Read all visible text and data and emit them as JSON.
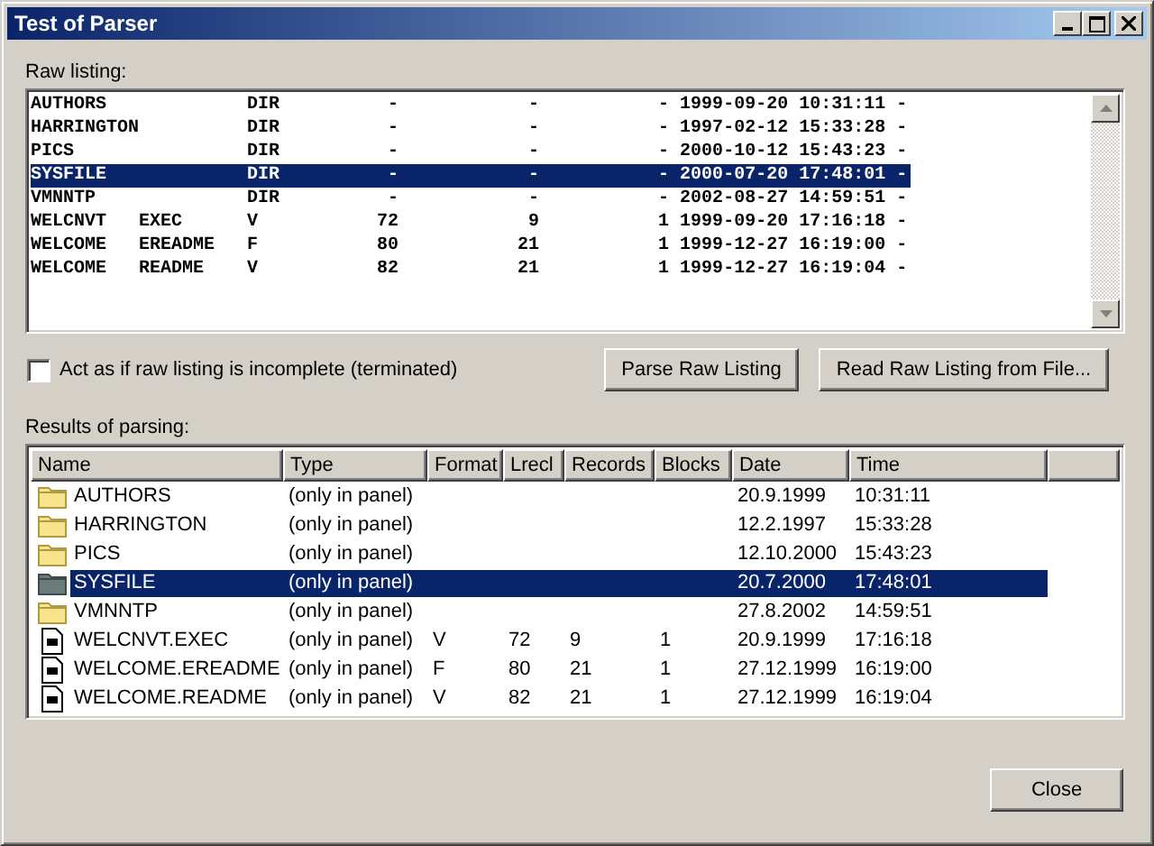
{
  "window": {
    "title": "Test of Parser"
  },
  "raw_listing": {
    "label": "Raw listing:",
    "lines": [
      {
        "text": "AUTHORS             DIR          -            -           - 1999-09-20 10:31:11 -",
        "selected": false
      },
      {
        "text": "HARRINGTON          DIR          -            -           - 1997-02-12 15:33:28 -",
        "selected": false
      },
      {
        "text": "PICS                DIR          -            -           - 2000-10-12 15:43:23 -",
        "selected": false
      },
      {
        "text": "SYSFILE             DIR          -            -           - 2000-07-20 17:48:01 -",
        "selected": true
      },
      {
        "text": "VMNNTP              DIR          -            -           - 2002-08-27 14:59:51 -",
        "selected": false
      },
      {
        "text": "WELCNVT   EXEC      V           72            9           1 1999-09-20 17:16:18 -",
        "selected": false
      },
      {
        "text": "WELCOME   EREADME   F           80           21           1 1999-12-27 16:19:00 -",
        "selected": false
      },
      {
        "text": "WELCOME   README    V           82           21           1 1999-12-27 16:19:04 -",
        "selected": false
      }
    ]
  },
  "incomplete_checkbox": {
    "label": "Act as if raw listing is incomplete (terminated)",
    "checked": false
  },
  "buttons": [
    "Parse Raw Listing",
    "Read Raw Listing from File..."
  ],
  "results": {
    "label": "Results of parsing:",
    "columns": [
      "Name",
      "Type",
      "Format",
      "Lrecl",
      "Records",
      "Blocks",
      "Date",
      "Time"
    ],
    "rows": [
      {
        "kind": "folder",
        "selected": false,
        "name": "AUTHORS",
        "type": "(only in panel)",
        "date": "20.9.1999",
        "time": "10:31:11"
      },
      {
        "kind": "folder",
        "selected": false,
        "name": "HARRINGTON",
        "type": "(only in panel)",
        "date": "12.2.1997",
        "time": "15:33:28"
      },
      {
        "kind": "folder",
        "selected": false,
        "name": "PICS",
        "type": "(only in panel)",
        "date": "12.10.2000",
        "time": "15:43:23"
      },
      {
        "kind": "folder",
        "selected": true,
        "name": "SYSFILE",
        "type": "(only in panel)",
        "date": "20.7.2000",
        "time": "17:48:01"
      },
      {
        "kind": "folder",
        "selected": false,
        "name": "VMNNTP",
        "type": "(only in panel)",
        "date": "27.8.2002",
        "time": "14:59:51"
      },
      {
        "kind": "file",
        "selected": false,
        "name": "WELCNVT.EXEC",
        "type": "(only in panel)",
        "format": "V",
        "lrecl": "72",
        "records": "9",
        "blocks": "1",
        "date": "20.9.1999",
        "time": "17:16:18"
      },
      {
        "kind": "file",
        "selected": false,
        "name": "WELCOME.EREADME",
        "type": "(only in panel)",
        "format": "F",
        "lrecl": "80",
        "records": "21",
        "blocks": "1",
        "date": "27.12.1999",
        "time": "16:19:00"
      },
      {
        "kind": "file",
        "selected": false,
        "name": "WELCOME.README",
        "type": "(only in panel)",
        "format": "V",
        "lrecl": "82",
        "records": "21",
        "blocks": "1",
        "date": "27.12.1999",
        "time": "16:19:04"
      }
    ]
  },
  "close_button": "Close"
}
